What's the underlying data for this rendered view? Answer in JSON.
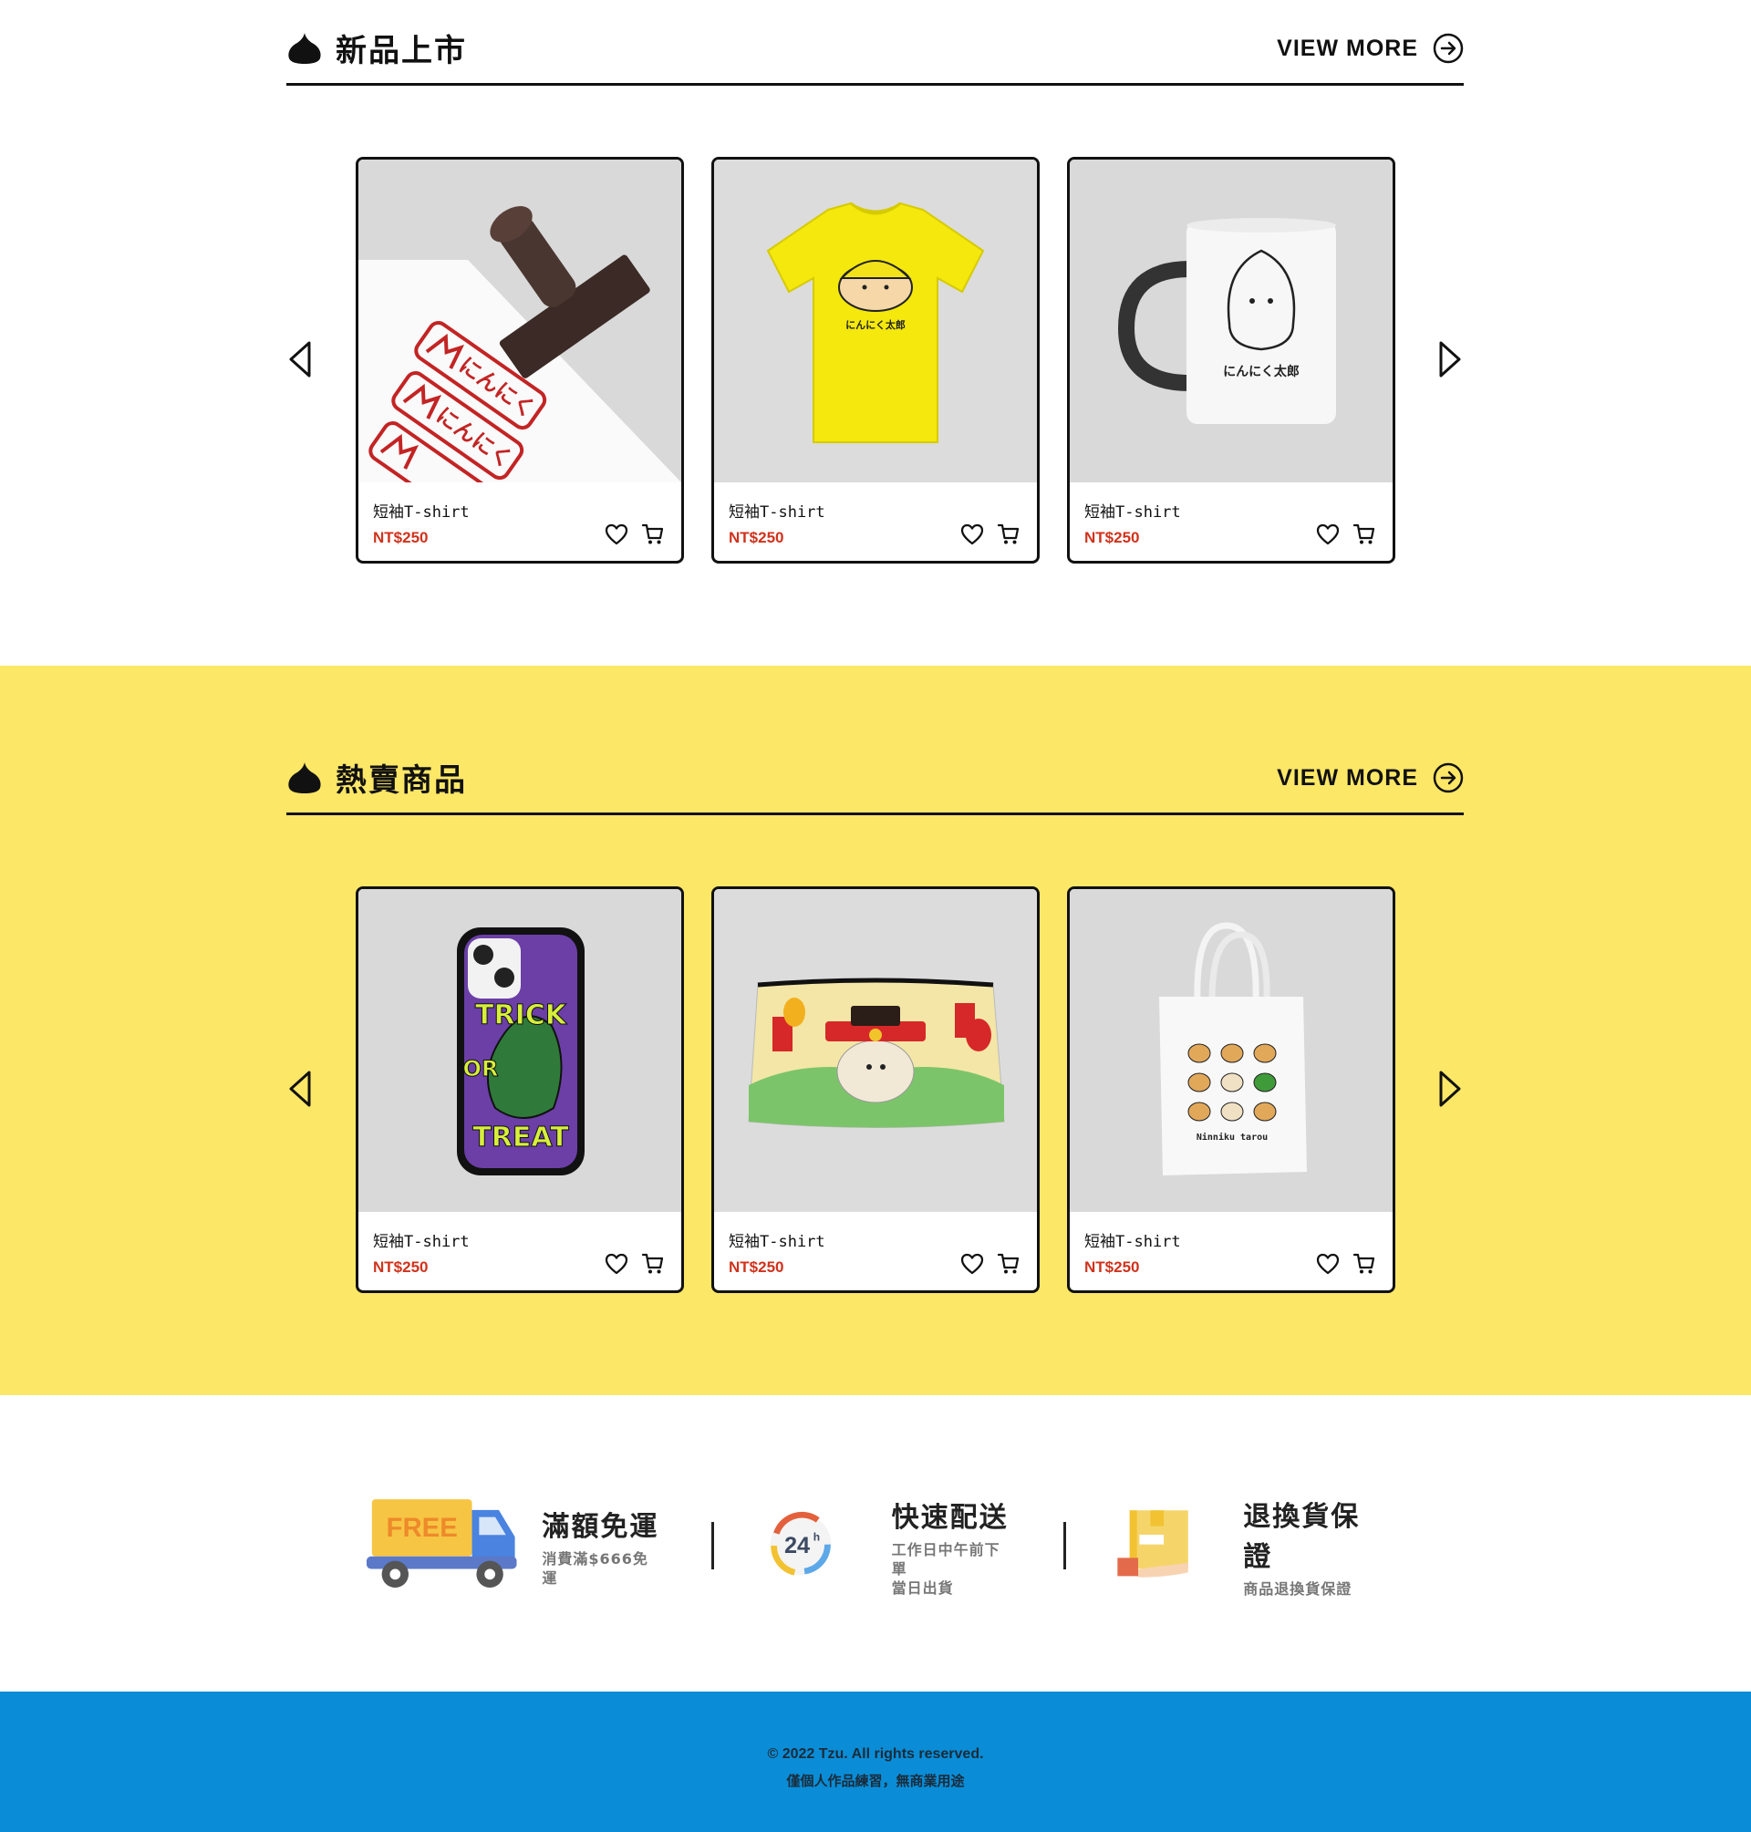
{
  "sections": {
    "new_arrivals": {
      "title": "新品上市",
      "view_more": "VIEW MORE",
      "products": [
        {
          "image": "stamp",
          "name": "短袖T-shirt",
          "price": "NT$250"
        },
        {
          "image": "yellow-tshirt",
          "name": "短袖T-shirt",
          "price": "NT$250"
        },
        {
          "image": "mug",
          "name": "短袖T-shirt",
          "price": "NT$250"
        }
      ]
    },
    "best_sellers": {
      "title": "熱賣商品",
      "view_more": "VIEW MORE",
      "products": [
        {
          "image": "phone-case",
          "name": "短袖T-shirt",
          "price": "NT$250"
        },
        {
          "image": "pouch",
          "name": "短袖T-shirt",
          "price": "NT$250"
        },
        {
          "image": "tote-bag",
          "name": "短袖T-shirt",
          "price": "NT$250"
        }
      ]
    }
  },
  "product_art_text": {
    "stamp": "にんにく",
    "mug": "にんにく太郎",
    "tshirt": "にんにく太郎",
    "phone_case_1": "TRICK",
    "phone_case_2": "OR",
    "phone_case_3": "TREAT",
    "tote": "Ninniku tarou"
  },
  "services": [
    {
      "icon": "free-shipping-truck-icon",
      "badge": "FREE",
      "title": "滿額免運",
      "desc": [
        "消費滿$666免運"
      ]
    },
    {
      "icon": "24h-delivery-icon",
      "badge": "24",
      "badge_sup": "h",
      "title": "快速配送",
      "desc": [
        "工作日中午前下單",
        "當日出貨"
      ]
    },
    {
      "icon": "return-box-icon",
      "title": "退換貨保證",
      "desc": [
        "商品退換貨保證"
      ]
    }
  ],
  "footer": {
    "copyright": "© 2022 Tzu. All rights reserved.",
    "note": "僅個人作品練習，無商業用途"
  },
  "colors": {
    "accent_yellow": "#fde767",
    "footer_blue": "#0a8dd6",
    "price_red": "#d0321c",
    "border": "#111111"
  }
}
